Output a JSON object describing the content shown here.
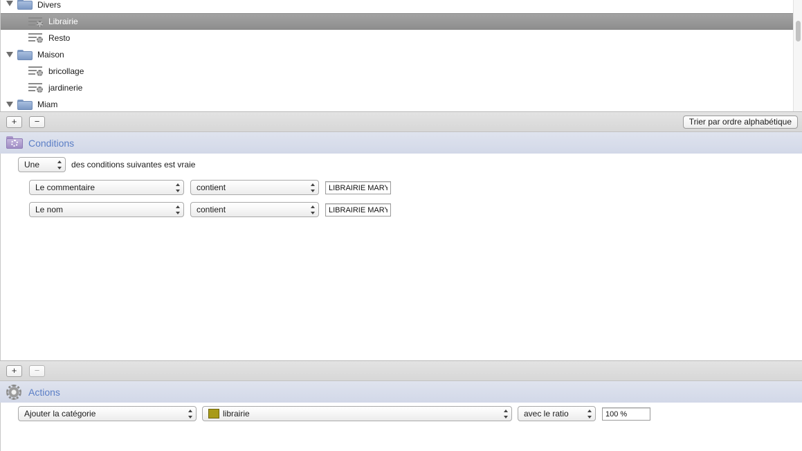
{
  "tree": {
    "rows": [
      {
        "kind": "folder",
        "label": "Divers"
      },
      {
        "kind": "rule",
        "label": "Librairie",
        "selected": true
      },
      {
        "kind": "rule",
        "label": "Resto"
      },
      {
        "kind": "folder",
        "label": "Maison"
      },
      {
        "kind": "rule",
        "label": "bricollage"
      },
      {
        "kind": "rule",
        "label": "jardinerie"
      },
      {
        "kind": "folder",
        "label": "Miam"
      }
    ]
  },
  "tree_bar": {
    "add_label": "+",
    "remove_label": "−",
    "sort_label": "Trier par ordre alphabétique"
  },
  "conditions": {
    "title": "Conditions",
    "match_select": "Une",
    "match_suffix": "des conditions suivantes est vraie",
    "rows": [
      {
        "field": "Le commentaire",
        "operator": "contient",
        "value": "LIBRAIRIE MARY"
      },
      {
        "field": "Le nom",
        "operator": "contient",
        "value": "LIBRAIRIE MARY"
      }
    ],
    "add_label": "+",
    "remove_label": "−"
  },
  "actions": {
    "title": "Actions",
    "action_select": "Ajouter la catégorie",
    "category_select": "librairie",
    "category_color": "#a89a18",
    "ratio_select": "avec le ratio",
    "ratio_value": "100 %"
  }
}
